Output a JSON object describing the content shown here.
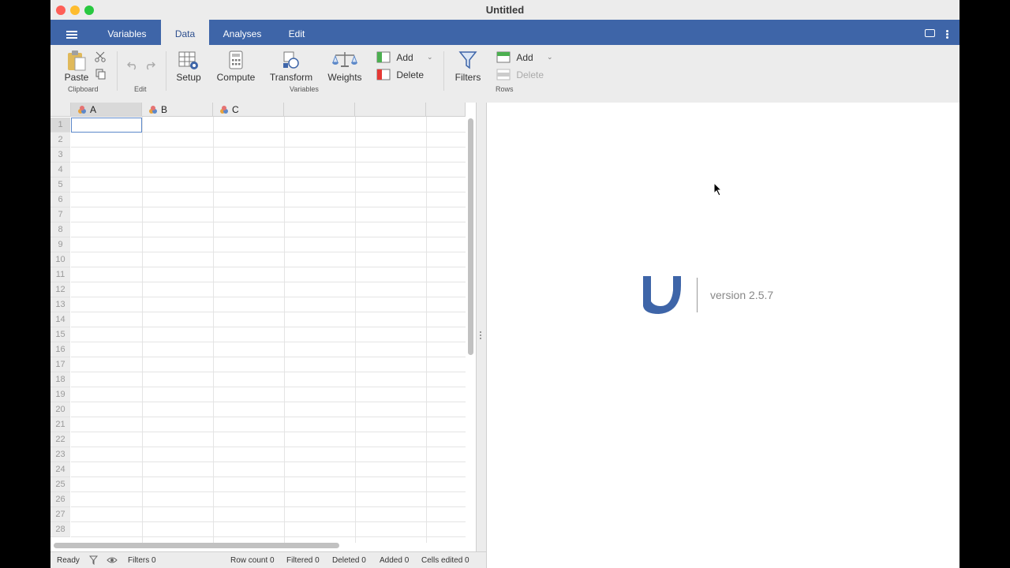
{
  "window": {
    "title": "Untitled"
  },
  "menubar": {
    "tabs": [
      {
        "label": "Variables"
      },
      {
        "label": "Data"
      },
      {
        "label": "Analyses"
      },
      {
        "label": "Edit"
      }
    ],
    "active_tab": "Data"
  },
  "ribbon": {
    "clipboard": {
      "paste": "Paste",
      "group": "Clipboard"
    },
    "edit": {
      "group": "Edit"
    },
    "variables": {
      "setup": "Setup",
      "compute": "Compute",
      "transform": "Transform",
      "weights": "Weights",
      "add": "Add",
      "delete": "Delete",
      "group": "Variables"
    },
    "rows": {
      "filters": "Filters",
      "add": "Add",
      "delete": "Delete",
      "group": "Rows"
    }
  },
  "sheet": {
    "columns": [
      {
        "name": "A"
      },
      {
        "name": "B"
      },
      {
        "name": "C"
      }
    ],
    "rows": [
      "1",
      "2",
      "3",
      "4",
      "5",
      "6",
      "7",
      "8",
      "9",
      "10",
      "11",
      "12",
      "13",
      "14",
      "15",
      "16",
      "17",
      "18",
      "19",
      "20",
      "21",
      "22",
      "23",
      "24",
      "25",
      "26",
      "27",
      "28"
    ]
  },
  "status": {
    "ready": "Ready",
    "filters": "Filters 0",
    "row_count": "Row count 0",
    "filtered": "Filtered 0",
    "deleted": "Deleted 0",
    "added": "Added 0",
    "cells_edited": "Cells edited 0"
  },
  "results": {
    "version": "version 2.5.7"
  },
  "colors": {
    "brand": "#3e65a8",
    "selection": "#5c88c9"
  }
}
